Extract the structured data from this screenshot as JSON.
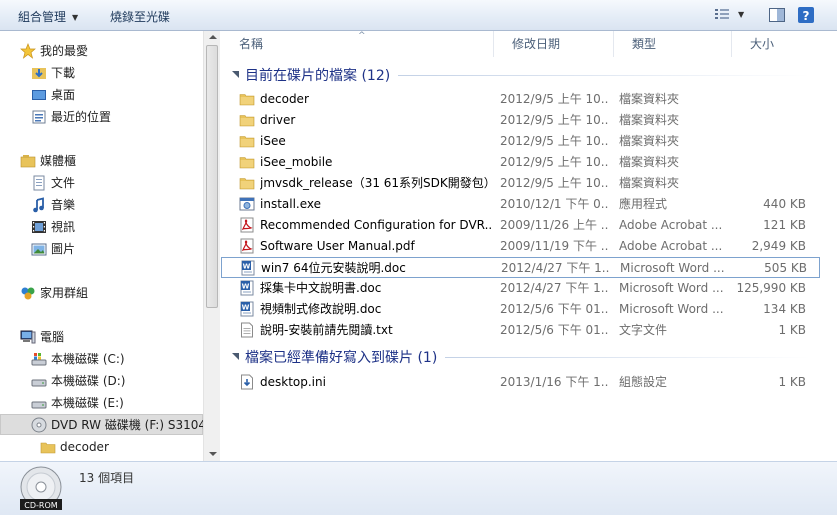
{
  "toolbar": {
    "organize": "組合管理",
    "burn": "燒錄至光碟"
  },
  "nav": {
    "favorites": "我的最愛",
    "downloads": "下載",
    "desktop": "桌面",
    "recent": "最近的位置",
    "libraries": "媒體櫃",
    "documents": "文件",
    "music": "音樂",
    "videos": "視訊",
    "pictures": "圖片",
    "homegroup": "家用群組",
    "computer": "電腦",
    "drive_c": "本機磁碟 (C:)",
    "drive_d": "本機磁碟 (D:)",
    "drive_e": "本機磁碟 (E:)",
    "drive_f": "DVD RW 磁碟機 (F:) S3104",
    "folder_decoder": "decoder"
  },
  "columns": {
    "name": "名稱",
    "date": "修改日期",
    "type": "類型",
    "size": "大小"
  },
  "groups": {
    "on_disc": "目前在碟片的檔案 (12)",
    "ready": "檔案已經準備好寫入到碟片 (1)"
  },
  "files": [
    {
      "icon": "folder-icon",
      "name": "decoder",
      "date": "2012/9/5 上午 10...",
      "type": "檔案資料夾",
      "size": ""
    },
    {
      "icon": "folder-icon",
      "name": "driver",
      "date": "2012/9/5 上午 10...",
      "type": "檔案資料夾",
      "size": ""
    },
    {
      "icon": "folder-icon",
      "name": "iSee",
      "date": "2012/9/5 上午 10...",
      "type": "檔案資料夾",
      "size": ""
    },
    {
      "icon": "folder-icon",
      "name": "iSee_mobile",
      "date": "2012/9/5 上午 10...",
      "type": "檔案資料夾",
      "size": ""
    },
    {
      "icon": "folder-icon",
      "name": "jmvsdk_release（31 61系列SDK開發包）",
      "date": "2012/9/5 上午 10...",
      "type": "檔案資料夾",
      "size": ""
    },
    {
      "icon": "exe-icon",
      "name": "install.exe",
      "date": "2010/12/1 下午 0...",
      "type": "應用程式",
      "size": "440 KB"
    },
    {
      "icon": "pdf-icon",
      "name": "Recommended Configuration for DVR...",
      "date": "2009/11/26 上午 ...",
      "type": "Adobe Acrobat ...",
      "size": "121 KB"
    },
    {
      "icon": "pdf-icon",
      "name": "Software User Manual.pdf",
      "date": "2009/11/19 下午 ...",
      "type": "Adobe Acrobat ...",
      "size": "2,949 KB"
    },
    {
      "icon": "word-icon",
      "name": "win7 64位元安裝說明.doc",
      "date": "2012/4/27 下午 1...",
      "type": "Microsoft Word ...",
      "size": "505 KB"
    },
    {
      "icon": "word-icon",
      "name": "採集卡中文說明書.doc",
      "date": "2012/4/27 下午 1...",
      "type": "Microsoft Word ...",
      "size": "125,990 KB"
    },
    {
      "icon": "word-icon",
      "name": "視頻制式修改說明.doc",
      "date": "2012/5/6 下午 01...",
      "type": "Microsoft Word ...",
      "size": "134 KB"
    },
    {
      "icon": "txt-icon",
      "name": "說明-安裝前請先閱讀.txt",
      "date": "2012/5/6 下午 01...",
      "type": "文字文件",
      "size": "1 KB"
    }
  ],
  "pending": [
    {
      "icon": "ini-icon",
      "name": "desktop.ini",
      "date": "2013/1/16 下午 1...",
      "type": "組態設定",
      "size": "1 KB"
    }
  ],
  "status": {
    "count": "13 個項目",
    "cd_label": "CD-ROM"
  },
  "colors": {
    "group_text": "#1e3287",
    "selection_border": "#7da2ce",
    "folder": "#e8c35a"
  }
}
